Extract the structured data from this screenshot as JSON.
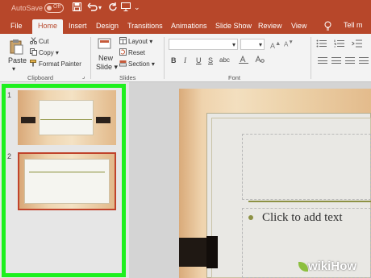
{
  "titlebar": {
    "autosave_label": "AutoSave",
    "autosave_state": "Off"
  },
  "tabs": [
    {
      "label": "File"
    },
    {
      "label": "Home"
    },
    {
      "label": "Insert"
    },
    {
      "label": "Design"
    },
    {
      "label": "Transitions"
    },
    {
      "label": "Animations"
    },
    {
      "label": "Slide Show"
    },
    {
      "label": "Review"
    },
    {
      "label": "View"
    }
  ],
  "tell_me": "Tell m",
  "ribbon": {
    "clipboard": {
      "paste": "Paste",
      "cut": "Cut",
      "copy": "Copy",
      "format_painter": "Format Painter",
      "group_label": "Clipboard"
    },
    "slides": {
      "new_slide_line1": "New",
      "new_slide_line2": "Slide",
      "layout": "Layout",
      "reset": "Reset",
      "section": "Section",
      "group_label": "Slides"
    },
    "font": {
      "bold": "B",
      "italic": "I",
      "underline": "U",
      "strike": "S",
      "shadow": "abc",
      "group_label": "Font"
    }
  },
  "thumbnails": [
    {
      "number": "1"
    },
    {
      "number": "2"
    }
  ],
  "slide": {
    "body_placeholder": "Click to add text"
  },
  "watermark": {
    "part1": "wiki",
    "part2": "How"
  },
  "colors": {
    "accent": "#b7472a",
    "selection_highlight": "#1ef01e",
    "rule": "#8d9144"
  }
}
